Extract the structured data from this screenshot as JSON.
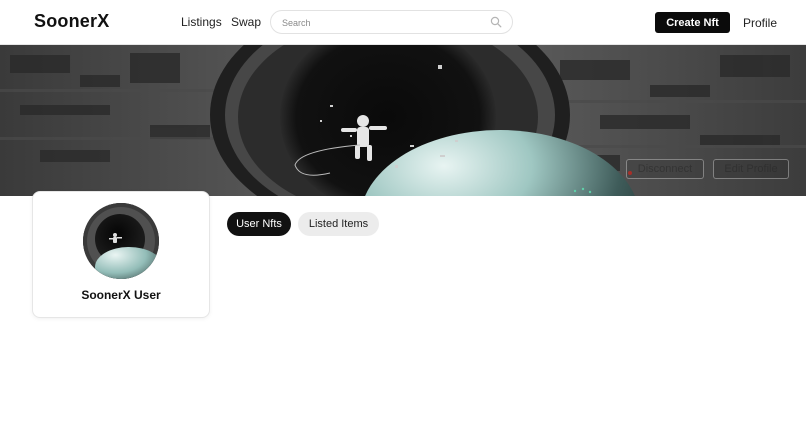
{
  "header": {
    "logo": "SoonerX",
    "nav": {
      "listings": "Listings",
      "swap": "Swap",
      "profile": "Profile"
    },
    "search": {
      "placeholder": "Search",
      "icon": "search-icon"
    },
    "create_button": "Create Nft"
  },
  "banner": {
    "disconnect_label": "Disconnect",
    "edit_profile_label": "Edit Profile"
  },
  "profile": {
    "name": "SoonerX User"
  },
  "tabs": [
    {
      "label": "User Nfts",
      "active": true
    },
    {
      "label": "Listed Items",
      "active": false
    }
  ],
  "colors": {
    "primary": "#0b0b0b",
    "tab_inactive_bg": "#ececec",
    "page_bg": "#ffffff"
  }
}
